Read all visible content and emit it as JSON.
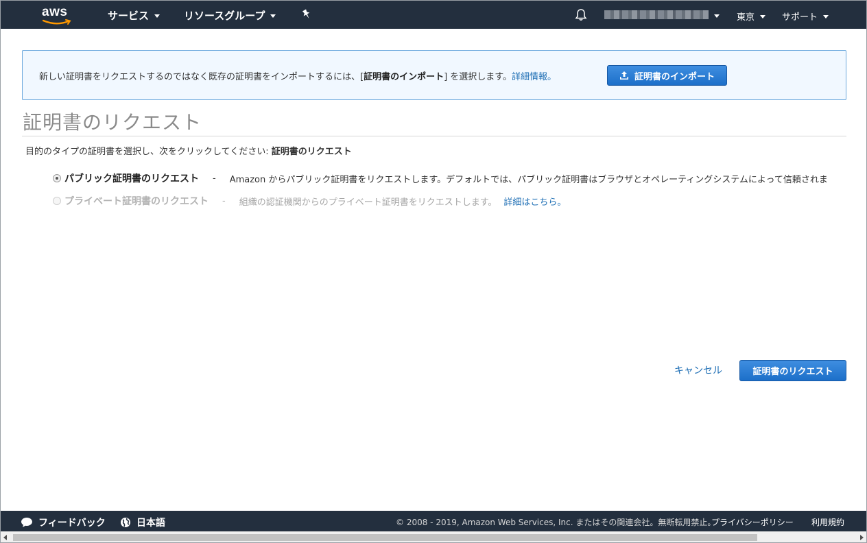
{
  "topnav": {
    "logo_text": "aws",
    "services_label": "サービス",
    "resource_groups_label": "リソースグループ",
    "region_label": "東京",
    "support_label": "サポート"
  },
  "banner": {
    "text_prefix": "新しい証明書をリクエストするのではなく既存の証明書をインポートするには、[",
    "text_bold": "証明書のインポート",
    "text_suffix": "] を選択します。",
    "learn_more": "詳細情報。",
    "import_button": "証明書のインポート"
  },
  "page": {
    "title": "証明書のリクエスト",
    "instruction_prefix": "目的のタイプの証明書を選択し、次をクリックしてください: ",
    "instruction_bold": "証明書のリクエスト"
  },
  "options": [
    {
      "title": "パブリック証明書のリクエスト",
      "dash": "-",
      "description": "Amazon からパブリック証明書をリクエストします。デフォルトでは、パブリック証明書はブラウザとオペレーティングシステムによって信頼されま",
      "selected": true,
      "enabled": true
    },
    {
      "title": "プライベート証明書のリクエスト",
      "dash": "-",
      "description": "組織の認証機関からのプライベート証明書をリクエストします。",
      "link": "詳細はこちら。",
      "selected": false,
      "enabled": false
    }
  ],
  "actions": {
    "cancel_label": "キャンセル",
    "request_label": "証明書のリクエスト"
  },
  "footer": {
    "feedback_label": "フィードバック",
    "language_label": "日本語",
    "copyright": "© 2008 - 2019, Amazon Web Services, Inc. またはその関連会社。無断転用禁止。",
    "privacy_label": "プライバシーポリシー",
    "terms_label": "利用規約"
  },
  "icons": {
    "bell": "bell-icon",
    "pin": "pin-icon",
    "upload": "upload-icon",
    "feedback": "speech-bubble-icon",
    "globe": "globe-icon"
  },
  "colors": {
    "nav_bg": "#232f3e",
    "primary_button": "#1c6fc9",
    "link": "#1f6fb5",
    "banner_bg": "#f1f8ff",
    "banner_border": "#6aa7dc"
  }
}
